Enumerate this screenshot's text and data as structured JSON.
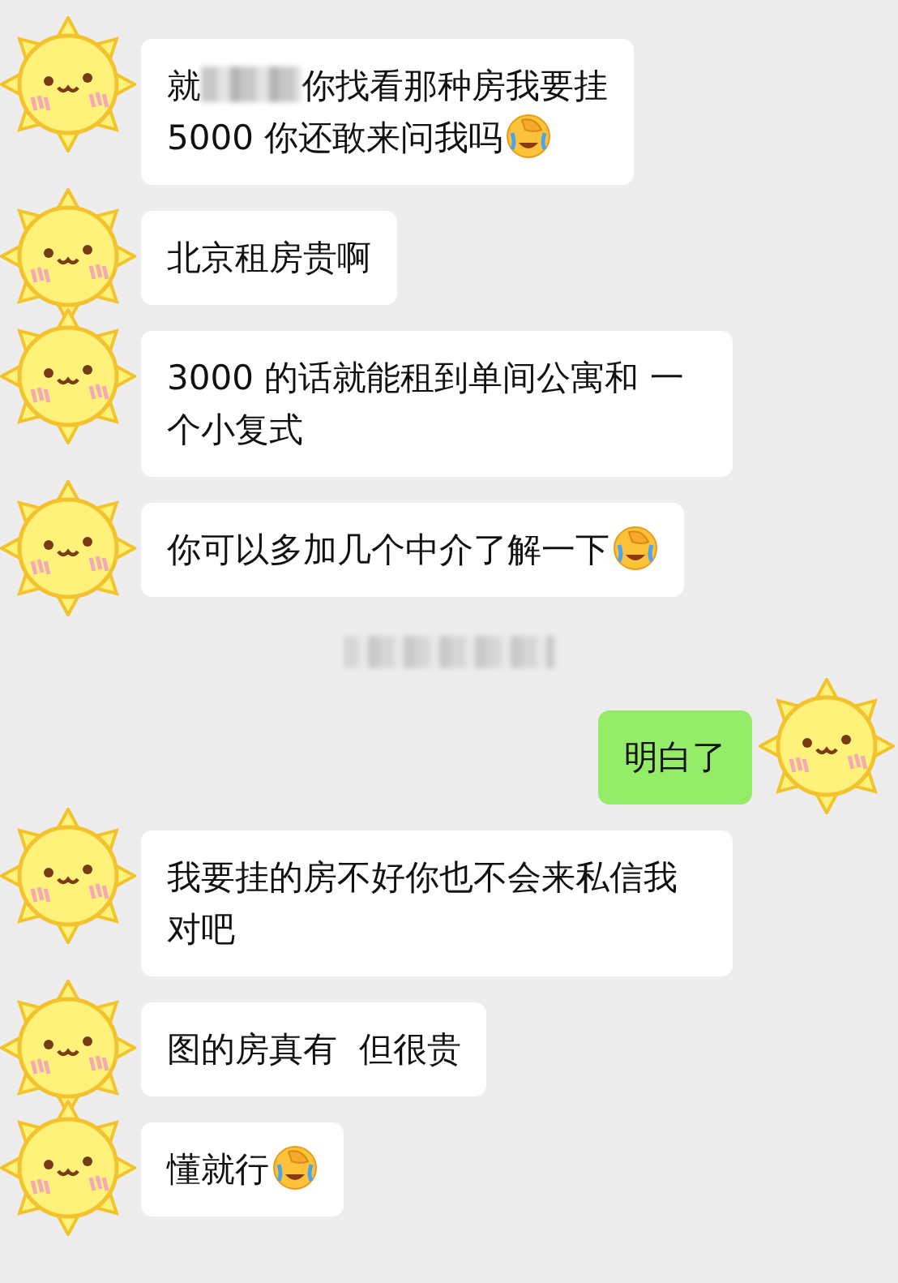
{
  "messages": [
    {
      "kind": "received",
      "parts": [
        {
          "kind": "text",
          "text": "就"
        },
        {
          "kind": "redacted"
        },
        {
          "kind": "text",
          "text": "你找看那种房我要挂"
        },
        {
          "kind": "break"
        },
        {
          "kind": "text",
          "text": "5000 你还敢来问我吗"
        },
        {
          "kind": "emoji"
        }
      ]
    },
    {
      "kind": "received",
      "parts": [
        {
          "kind": "text",
          "text": "北京租房贵啊"
        }
      ]
    },
    {
      "kind": "received",
      "parts": [
        {
          "kind": "text",
          "text": "3000 的话就能租到单间公寓和 一个小复式"
        }
      ]
    },
    {
      "kind": "received",
      "parts": [
        {
          "kind": "text",
          "text": "你可以多加几个中介了解一下"
        },
        {
          "kind": "emoji"
        }
      ]
    },
    {
      "kind": "time_redacted"
    },
    {
      "kind": "sent",
      "parts": [
        {
          "kind": "text",
          "text": "明白了"
        }
      ]
    },
    {
      "kind": "received",
      "parts": [
        {
          "kind": "text",
          "text": "我要挂的房不好你也不会来私信我对吧"
        }
      ]
    },
    {
      "kind": "received",
      "parts": [
        {
          "kind": "text",
          "text": "图的房真有  但很贵"
        }
      ]
    },
    {
      "kind": "received",
      "parts": [
        {
          "kind": "text",
          "text": "懂就行"
        },
        {
          "kind": "emoji"
        }
      ]
    }
  ]
}
